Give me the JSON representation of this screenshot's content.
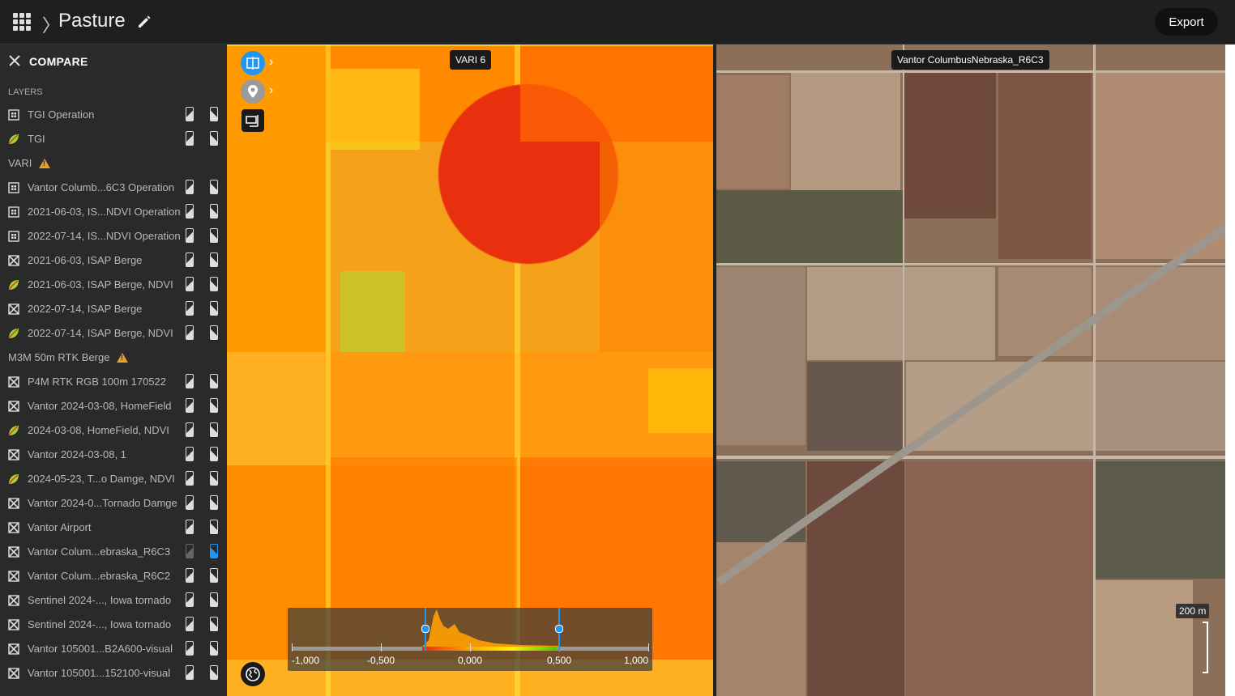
{
  "header": {
    "title": "Pasture",
    "export_label": "Export"
  },
  "sidebar": {
    "compare_label": "COMPARE",
    "layers_label": "LAYERS",
    "rows": [
      {
        "label": "TGI Operation",
        "icon": "operation-icon",
        "group": false
      },
      {
        "label": "TGI",
        "icon": "leaf-icon",
        "group": false
      },
      {
        "label": "VARI",
        "group": true,
        "warning": true
      },
      {
        "label": "Vantor Columb...6C3 Operation",
        "icon": "operation-icon",
        "group": false
      },
      {
        "label": "2021-06-03, IS...NDVI Operation",
        "icon": "operation-icon",
        "group": false
      },
      {
        "label": "2022-07-14, IS...NDVI Operation",
        "icon": "operation-icon",
        "group": false
      },
      {
        "label": "2021-06-03, ISAP Berge",
        "icon": "image-icon",
        "group": false
      },
      {
        "label": "2021-06-03, ISAP Berge, NDVI",
        "icon": "leaf-icon",
        "group": false
      },
      {
        "label": "2022-07-14, ISAP Berge",
        "icon": "image-icon",
        "group": false
      },
      {
        "label": "2022-07-14, ISAP Berge, NDVI",
        "icon": "leaf-icon",
        "group": false
      },
      {
        "label": "M3M 50m RTK Berge",
        "group": true,
        "warning": true
      },
      {
        "label": "P4M RTK RGB 100m 170522",
        "icon": "image-icon",
        "group": false
      },
      {
        "label": "Vantor 2024-03-08, HomeField",
        "icon": "image-icon",
        "group": false
      },
      {
        "label": "2024-03-08, HomeField, NDVI",
        "icon": "leaf-icon",
        "group": false
      },
      {
        "label": "Vantor 2024-03-08, 1",
        "icon": "image-icon",
        "group": false
      },
      {
        "label": "2024-05-23, T...o Damge, NDVI",
        "icon": "leaf-icon",
        "group": false
      },
      {
        "label": "Vantor 2024-0...Tornado Damge",
        "icon": "image-icon",
        "group": false
      },
      {
        "label": "Vantor Airport",
        "icon": "image-icon",
        "group": false
      },
      {
        "label": "Vantor Colum...ebraska_R6C3",
        "icon": "image-icon",
        "group": false,
        "right_active": true
      },
      {
        "label": "Vantor Colum...ebraska_R6C2",
        "icon": "image-icon",
        "group": false
      },
      {
        "label": "Sentinel 2024-..., Iowa tornado",
        "icon": "image-icon",
        "group": false
      },
      {
        "label": "Sentinel 2024-..., Iowa tornado",
        "icon": "image-icon",
        "group": false
      },
      {
        "label": "Vantor 105001...B2A600-visual",
        "icon": "image-icon",
        "group": false
      },
      {
        "label": "Vantor 105001...152100-visual",
        "icon": "image-icon",
        "group": false
      }
    ]
  },
  "map": {
    "left_label": "VARI 6",
    "right_label": "Vantor ColumbusNebraska_R6C3",
    "scale_label": "200 m"
  },
  "histogram": {
    "ticks": [
      "-1,000",
      "-0,500",
      "0,000",
      "0,500",
      "1,000"
    ],
    "range_min": -1,
    "range_max": 1,
    "handle_low": -0.25,
    "handle_high": 0.5
  },
  "colors": {
    "accent": "#2196f3",
    "warning": "#f0a020",
    "panel": "#2a2a2a"
  }
}
